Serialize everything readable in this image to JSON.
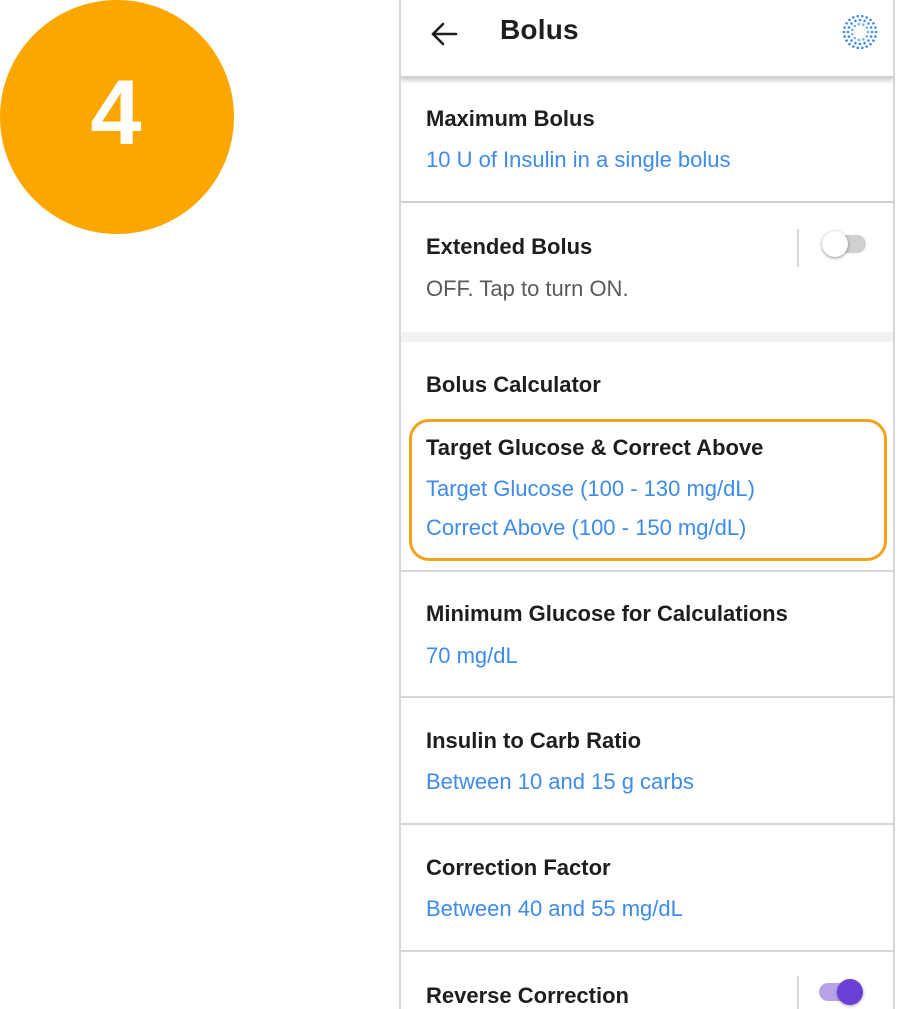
{
  "step_badge": "4",
  "app_bar": {
    "title": "Bolus",
    "back_icon": "arrow-left-icon",
    "sensor_icon": "dotted-circle-icon"
  },
  "items": {
    "maximum_bolus": {
      "title": "Maximum Bolus",
      "value": "10 U of Insulin in a single bolus"
    },
    "extended_bolus": {
      "title": "Extended Bolus",
      "status": "OFF. Tap to turn ON.",
      "toggle_on": false
    },
    "bolus_calculator": {
      "title": "Bolus Calculator"
    },
    "target_glucose": {
      "title": "Target Glucose & Correct Above",
      "value1": "Target Glucose (100 - 130 mg/dL)",
      "value2": "Correct Above (100 - 150 mg/dL)"
    },
    "minimum_glucose": {
      "title": "Minimum Glucose for Calculations",
      "value": "70 mg/dL"
    },
    "insulin_carb_ratio": {
      "title": "Insulin to Carb Ratio",
      "value": "Between 10 and 15 g carbs"
    },
    "correction_factor": {
      "title": "Correction Factor",
      "value": "Between 40 and 55 mg/dL"
    },
    "reverse_correction": {
      "title": "Reverse Correction",
      "toggle_on": true
    }
  },
  "colors": {
    "badge": "#FBA700",
    "link_value": "#3D8BEA",
    "highlight_outline": "#F2A31B",
    "toggle_on": "#6A3FD6"
  }
}
